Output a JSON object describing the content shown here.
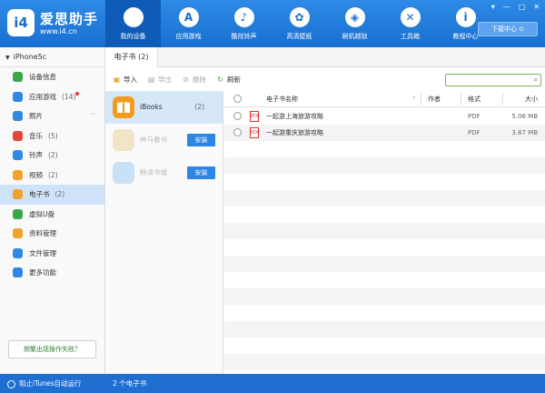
{
  "app": {
    "name": "爱思助手",
    "url": "www.i4.cn",
    "logo_text": "i4"
  },
  "window_controls": [
    "▾",
    "—",
    "▢",
    "✕"
  ],
  "nav": [
    {
      "label": "我的设备",
      "icon": "apple-icon",
      "glyph": "",
      "active": true
    },
    {
      "label": "应用游戏",
      "icon": "appstore-icon",
      "glyph": "A"
    },
    {
      "label": "酷炫铃声",
      "icon": "bell-icon",
      "glyph": "♪"
    },
    {
      "label": "高清壁纸",
      "icon": "flower-icon",
      "glyph": "✿"
    },
    {
      "label": "刷机越狱",
      "icon": "box-icon",
      "glyph": "◈"
    },
    {
      "label": "工具箱",
      "icon": "tools-icon",
      "glyph": "✕"
    },
    {
      "label": "教程中心",
      "icon": "info-icon",
      "glyph": "i"
    }
  ],
  "download_center": "下载中心",
  "device": {
    "name": "iPhone5c"
  },
  "sidebar": [
    {
      "label": "设备信息",
      "count": "",
      "icon": "info-icon",
      "color": "#3aa84a"
    },
    {
      "label": "应用游戏",
      "count": "(14)",
      "icon": "appstore-icon",
      "color": "#2f88e3",
      "badge": true
    },
    {
      "label": "照片",
      "count": "",
      "icon": "photo-icon",
      "color": "#2f88e3",
      "expandable": true
    },
    {
      "label": "音乐",
      "count": "(5)",
      "icon": "music-icon",
      "color": "#e2453c"
    },
    {
      "label": "铃声",
      "count": "(2)",
      "icon": "bell-icon",
      "color": "#2f88e3"
    },
    {
      "label": "视频",
      "count": "(2)",
      "icon": "video-icon",
      "color": "#f0a328"
    },
    {
      "label": "电子书",
      "count": "(2)",
      "icon": "book-icon",
      "color": "#f0a328",
      "active": true
    },
    {
      "label": "虚拟U盘",
      "count": "",
      "icon": "usb-icon",
      "color": "#3aa84a"
    },
    {
      "label": "资料管理",
      "count": "",
      "icon": "contacts-icon",
      "color": "#f0a328"
    },
    {
      "label": "文件管理",
      "count": "",
      "icon": "file-icon",
      "color": "#2f88e3"
    },
    {
      "label": "更多功能",
      "count": "",
      "icon": "grid-icon",
      "color": "#2f88e3"
    }
  ],
  "help_link": "频繁出现操作失败？",
  "tab": {
    "label": "电子书 (2)"
  },
  "toolbar": {
    "import": "导入",
    "export": "导出",
    "delete": "删除",
    "refresh": "刷新"
  },
  "apps": [
    {
      "name": "iBooks",
      "count": "(2)",
      "active": true
    },
    {
      "name": "神马看书",
      "install": "安装"
    },
    {
      "name": "畅读书城",
      "install": "安装"
    }
  ],
  "table": {
    "headers": {
      "name": "电子书名称",
      "author": "作者",
      "format": "格式",
      "size": "大小"
    },
    "rows": [
      {
        "name": "一起游上海旅游攻略",
        "author": "",
        "format": "PDF",
        "size": "5.06 MB"
      },
      {
        "name": "一起游重庆旅游攻略",
        "author": "",
        "format": "PDF",
        "size": "3.87 MB"
      }
    ]
  },
  "status": {
    "itunes_toggle": "阻止iTunes自动运行",
    "count": "2 个电子书"
  },
  "colors": {
    "brand_blue": "#1a6fd0",
    "active_blue": "#0e5cb8",
    "selection": "#cfe3f8",
    "search_border": "#7ab65e"
  }
}
